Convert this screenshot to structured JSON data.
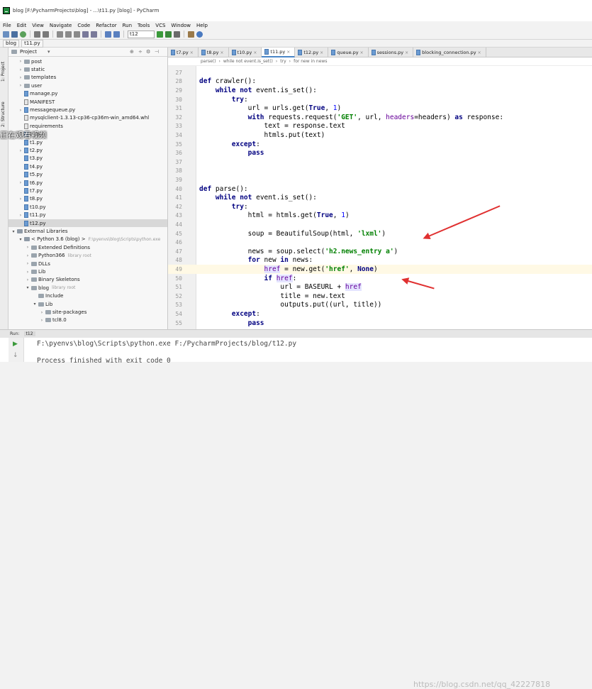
{
  "window": {
    "title": "blog [F:\\PycharmProjects\\blog] - ...\\t11.py [blog] - PyCharm"
  },
  "menu": [
    "File",
    "Edit",
    "View",
    "Navigate",
    "Code",
    "Refactor",
    "Run",
    "Tools",
    "VCS",
    "Window",
    "Help"
  ],
  "toolbar": {
    "run_config": "t12"
  },
  "navbar": {
    "crumbs": [
      "blog",
      "t11.py"
    ]
  },
  "sidestrip": {
    "project": "1: Project",
    "structure": "2: Structure"
  },
  "project": {
    "title": "Project",
    "tree": [
      {
        "label": "post",
        "type": "folder",
        "depth": 1,
        "arrow": ">"
      },
      {
        "label": "static",
        "type": "folder",
        "depth": 1,
        "arrow": ">"
      },
      {
        "label": "templates",
        "type": "folder",
        "depth": 1,
        "arrow": ">"
      },
      {
        "label": "user",
        "type": "folder",
        "depth": 1,
        "arrow": ">"
      },
      {
        "label": "manage.py",
        "type": "file",
        "depth": 1
      },
      {
        "label": "MANIFEST",
        "type": "txt",
        "depth": 1
      },
      {
        "label": "messagequeue.py",
        "type": "file",
        "depth": 1,
        "arrow": ">"
      },
      {
        "label": "mysqlclient-1.3.13-cp36-cp36m-win_amd64.whl",
        "type": "txt",
        "depth": 1
      },
      {
        "label": "requirements",
        "type": "txt",
        "depth": 1
      },
      {
        "label": "t1.py",
        "type": "file",
        "depth": 1
      },
      {
        "label": "t1.py",
        "type": "file",
        "depth": 1
      },
      {
        "label": "t2.py",
        "type": "file",
        "depth": 1,
        "arrow": ">"
      },
      {
        "label": "t3.py",
        "type": "file",
        "depth": 1
      },
      {
        "label": "t4.py",
        "type": "file",
        "depth": 1
      },
      {
        "label": "t5.py",
        "type": "file",
        "depth": 1
      },
      {
        "label": "t6.py",
        "type": "file",
        "depth": 1,
        "arrow": ">"
      },
      {
        "label": "t7.py",
        "type": "file",
        "depth": 1
      },
      {
        "label": "t8.py",
        "type": "file",
        "depth": 1,
        "arrow": ">"
      },
      {
        "label": "t10.py",
        "type": "file",
        "depth": 1
      },
      {
        "label": "t11.py",
        "type": "file",
        "depth": 1,
        "arrow": ">"
      },
      {
        "label": "t12.py",
        "type": "file",
        "depth": 1,
        "selected": true
      },
      {
        "label": "External Libraries",
        "type": "lib",
        "depth": 0,
        "arrow": "v"
      },
      {
        "label": "< Python 3.6 (blog) >",
        "type": "lib",
        "depth": 1,
        "arrow": "v",
        "extra": "F:\\pyenvs\\blog\\Scripts\\python.exe"
      },
      {
        "label": "Extended Definitions",
        "type": "folder",
        "depth": 2,
        "arrow": ">"
      },
      {
        "label": "Python366",
        "type": "folder",
        "depth": 2,
        "arrow": ">",
        "extra": "library root"
      },
      {
        "label": "DLLs",
        "type": "folder",
        "depth": 2,
        "arrow": ">"
      },
      {
        "label": "Lib",
        "type": "folder",
        "depth": 2,
        "arrow": ">"
      },
      {
        "label": "Binary Skeletons",
        "type": "folder",
        "depth": 2,
        "arrow": ">"
      },
      {
        "label": "blog",
        "type": "folder",
        "depth": 2,
        "arrow": "v",
        "extra": "library root"
      },
      {
        "label": "Include",
        "type": "folder",
        "depth": 3
      },
      {
        "label": "Lib",
        "type": "folder",
        "depth": 3,
        "arrow": "v"
      },
      {
        "label": "site-packages",
        "type": "folder",
        "depth": 4,
        "arrow": ">"
      },
      {
        "label": "tcl8.0",
        "type": "folder",
        "depth": 4,
        "arrow": ">"
      }
    ]
  },
  "tabs": [
    {
      "label": "t7.py"
    },
    {
      "label": "t8.py"
    },
    {
      "label": "t10.py"
    },
    {
      "label": "t11.py",
      "active": true
    },
    {
      "label": "t12.py"
    },
    {
      "label": "queue.py"
    },
    {
      "label": "sessions.py"
    },
    {
      "label": "blocking_connection.py"
    }
  ],
  "editor": {
    "breadcrumb": [
      "parse()",
      "while not event.is_set()",
      "try",
      "for new in news"
    ],
    "highlight_line": 49
  },
  "code": [
    {
      "n": "27",
      "t": []
    },
    {
      "n": "28",
      "t": [
        [
          "kw",
          "def "
        ],
        [
          "code",
          "crawler():"
        ]
      ]
    },
    {
      "n": "29",
      "t": [
        [
          "code",
          "    "
        ],
        [
          "kw",
          "while not "
        ],
        [
          "code",
          "event.is_set():"
        ]
      ]
    },
    {
      "n": "30",
      "t": [
        [
          "code",
          "        "
        ],
        [
          "kw",
          "try"
        ],
        [
          "code",
          ":"
        ]
      ]
    },
    {
      "n": "31",
      "t": [
        [
          "code",
          "            url = urls.get("
        ],
        [
          "kw",
          "True"
        ],
        [
          "code",
          ", "
        ],
        [
          "nm",
          "1"
        ],
        [
          "code",
          ")"
        ]
      ]
    },
    {
      "n": "32",
      "t": [
        [
          "code",
          "            "
        ],
        [
          "kw",
          "with "
        ],
        [
          "code",
          "requests.request("
        ],
        [
          "str",
          "'GET'"
        ],
        [
          "code",
          ", url, "
        ],
        [
          "kwarg",
          "headers"
        ],
        [
          "code",
          "=headers) "
        ],
        [
          "kw",
          "as "
        ],
        [
          "code",
          "response:"
        ]
      ]
    },
    {
      "n": "33",
      "t": [
        [
          "code",
          "                text = response.text"
        ]
      ]
    },
    {
      "n": "34",
      "t": [
        [
          "code",
          "                htmls.put(text)"
        ]
      ]
    },
    {
      "n": "35",
      "t": [
        [
          "code",
          "        "
        ],
        [
          "kw",
          "except"
        ],
        [
          "code",
          ":"
        ]
      ]
    },
    {
      "n": "36",
      "t": [
        [
          "code",
          "            "
        ],
        [
          "kw",
          "pass"
        ]
      ]
    },
    {
      "n": "37",
      "t": []
    },
    {
      "n": "38",
      "t": []
    },
    {
      "n": "39",
      "t": []
    },
    {
      "n": "40",
      "t": [
        [
          "kw",
          "def "
        ],
        [
          "code",
          "parse():"
        ]
      ]
    },
    {
      "n": "41",
      "t": [
        [
          "code",
          "    "
        ],
        [
          "kw",
          "while not "
        ],
        [
          "code",
          "event.is_set():"
        ]
      ]
    },
    {
      "n": "42",
      "t": [
        [
          "code",
          "        "
        ],
        [
          "kw",
          "try"
        ],
        [
          "code",
          ":"
        ]
      ]
    },
    {
      "n": "43",
      "t": [
        [
          "code",
          "            html = htmls.get("
        ],
        [
          "kw",
          "True"
        ],
        [
          "code",
          ", "
        ],
        [
          "nm",
          "1"
        ],
        [
          "code",
          ")"
        ]
      ]
    },
    {
      "n": "44",
      "t": []
    },
    {
      "n": "45",
      "t": [
        [
          "code",
          "            soup = BeautifulSoup(html, "
        ],
        [
          "str",
          "'lxml'"
        ],
        [
          "code",
          ")"
        ]
      ]
    },
    {
      "n": "46",
      "t": []
    },
    {
      "n": "47",
      "t": [
        [
          "code",
          "            news = soup.select("
        ],
        [
          "str",
          "'h2.news_entry a'"
        ],
        [
          "code",
          ")"
        ]
      ]
    },
    {
      "n": "48",
      "t": [
        [
          "code",
          "            "
        ],
        [
          "kw",
          "for "
        ],
        [
          "code",
          "new "
        ],
        [
          "kw",
          "in "
        ],
        [
          "code",
          "news:"
        ]
      ]
    },
    {
      "n": "49",
      "t": [
        [
          "code",
          "                "
        ],
        [
          "var",
          "href"
        ],
        [
          "code",
          " = new.get("
        ],
        [
          "str",
          "'href'"
        ],
        [
          "code",
          ", "
        ],
        [
          "kw",
          "None"
        ],
        [
          "code",
          ")"
        ]
      ]
    },
    {
      "n": "50",
      "t": [
        [
          "code",
          "                "
        ],
        [
          "kw",
          "if "
        ],
        [
          "var",
          "href"
        ],
        [
          "code",
          ":"
        ]
      ]
    },
    {
      "n": "51",
      "t": [
        [
          "code",
          "                    url = BASEURL + "
        ],
        [
          "var",
          "href"
        ]
      ]
    },
    {
      "n": "52",
      "t": [
        [
          "code",
          "                    title = new.text"
        ]
      ]
    },
    {
      "n": "53",
      "t": [
        [
          "code",
          "                    outputs.put((url, title))"
        ]
      ]
    },
    {
      "n": "54",
      "t": [
        [
          "code",
          "        "
        ],
        [
          "kw",
          "except"
        ],
        [
          "code",
          ":"
        ]
      ]
    },
    {
      "n": "55",
      "t": [
        [
          "code",
          "            "
        ],
        [
          "kw",
          "pass"
        ]
      ]
    }
  ],
  "bottom": {
    "run_label": "Run:",
    "tab": "t12"
  },
  "console": {
    "line1": "F:\\pyenvs\\blog\\Scripts\\python.exe F:/PycharmProjects/blog/t12.py",
    "line2": "Process finished with exit code 0"
  },
  "watermark": "https://blog.csdn.net/qq_42227818",
  "overlay": "正在观看视频",
  "colors": {
    "keyword": "#000080",
    "string": "#008000",
    "highlight": "#fff9e5",
    "arrow": "#e03030"
  }
}
